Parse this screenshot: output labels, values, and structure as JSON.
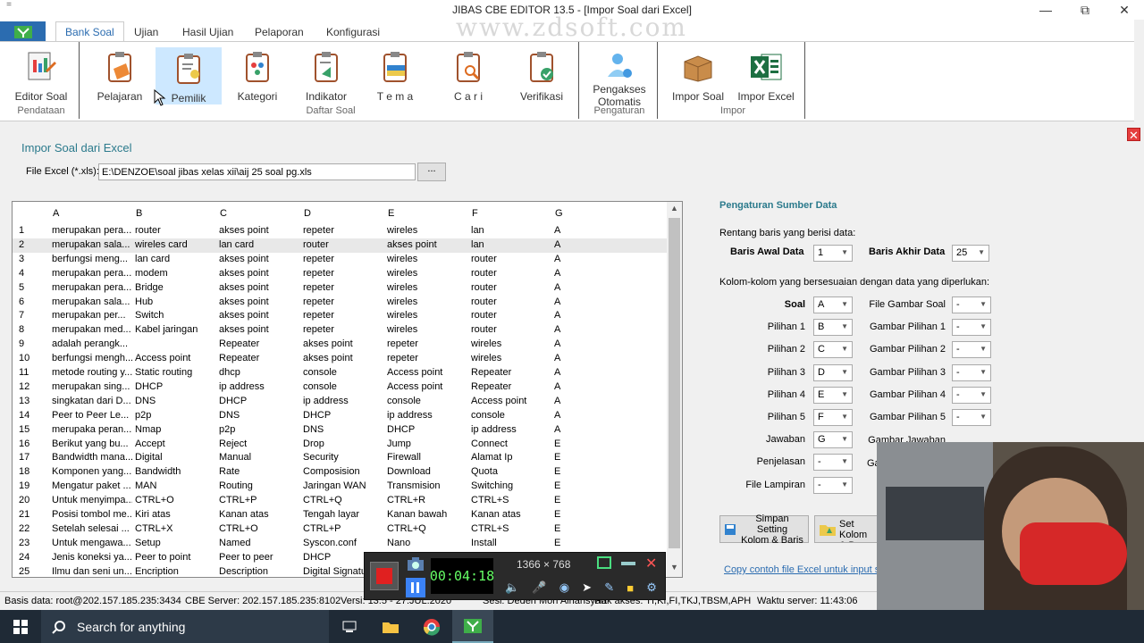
{
  "window": {
    "title": "JIBAS CBE EDITOR 13.5 - [Impor Soal dari Excel]"
  },
  "watermark": "www.zdsoft.com",
  "menu_glyph": "=",
  "tabs": [
    "Bank Soal",
    "Ujian",
    "Hasil Ujian",
    "Pelaporan",
    "Konfigurasi"
  ],
  "ribbon": {
    "buttons": {
      "editor_soal": "Editor Soal",
      "pelajaran": "Pelajaran",
      "pemilik": "Pemilik",
      "kategori": "Kategori",
      "indikator": "Indikator",
      "tema": "T e m a",
      "cari": "C a r i",
      "verifikasi": "Verifikasi",
      "pengakses_otomatis": "Pengakses\nOtomatis",
      "impor_soal": "Impor Soal",
      "impor_excel": "Impor Excel"
    },
    "groups": {
      "pendataan": "Pendataan",
      "daftar_soal": "Daftar Soal",
      "pengaturan": "Pengaturan",
      "impor": "Impor"
    }
  },
  "form": {
    "heading": "Impor Soal dari Excel",
    "file_label": "File Excel (*.xls):",
    "file_value": "E:\\DENZOE\\soal jibas xelas xii\\aij 25 soal pg.xls",
    "browse_label": "..."
  },
  "grid": {
    "columns": [
      "A",
      "B",
      "C",
      "D",
      "E",
      "F",
      "G"
    ],
    "selected_row": 2,
    "rows": [
      [
        "1",
        "merupakan pera...",
        "router",
        "akses point",
        "repeter",
        "wireles",
        "lan",
        "A"
      ],
      [
        "2",
        "merupakan sala...",
        "wireles card",
        "lan card",
        "router",
        "akses point",
        "lan",
        "A"
      ],
      [
        "3",
        "berfungsi meng...",
        "lan card",
        "akses point",
        "repeter",
        "wireles",
        "router",
        "A"
      ],
      [
        "4",
        "merupakan pera...",
        "modem",
        "akses point",
        "repeter",
        "wireles",
        "router",
        "A"
      ],
      [
        "5",
        "merupakan pera...",
        "Bridge",
        "akses point",
        "repeter",
        "wireles",
        "router",
        "A"
      ],
      [
        "6",
        "merupakan sala...",
        "Hub",
        "akses point",
        "repeter",
        "wireles",
        "router",
        "A"
      ],
      [
        "7",
        " merupakan per...",
        "Switch",
        "akses point",
        "repeter",
        "wireles",
        "router",
        "A"
      ],
      [
        "8",
        " merupakan med...",
        "Kabel jaringan",
        "akses point",
        "repeter",
        "wireles",
        "router",
        "A"
      ],
      [
        "9",
        "adalah perangk...",
        "",
        "Repeater",
        "akses point",
        "repeter",
        "wireles",
        "A"
      ],
      [
        "10",
        "berfungsi mengh...",
        "Access point",
        "Repeater",
        "akses point",
        "repeter",
        "wireles",
        "A"
      ],
      [
        "11",
        "metode routing y...",
        "Static routing",
        "dhcp",
        "console",
        "Access point",
        "Repeater",
        "A"
      ],
      [
        "12",
        "merupakan sing...",
        "DHCP",
        "ip address",
        "console",
        "Access point",
        "Repeater",
        "A"
      ],
      [
        "13",
        "singkatan dari D...",
        "DNS",
        "DHCP",
        "ip address",
        "console",
        "Access point",
        "A"
      ],
      [
        "14",
        "Peer to Peer Le...",
        "p2p",
        "DNS",
        "DHCP",
        "ip address",
        "console",
        "A"
      ],
      [
        "15",
        "merupaka peran...",
        "Nmap",
        "p2p",
        "DNS",
        "DHCP",
        "ip address",
        "A"
      ],
      [
        "16",
        "Berikut yang bu...",
        "Accept",
        "Reject",
        "Drop",
        "Jump",
        "Connect",
        "E"
      ],
      [
        "17",
        "Bandwidth mana...",
        "Digital",
        "Manual",
        "Security",
        "Firewall",
        "Alamat Ip",
        "E"
      ],
      [
        "18",
        "Komponen yang...",
        "Bandwidth",
        "Rate",
        "Composision",
        "Download",
        "Quota",
        "E"
      ],
      [
        "19",
        "Mengatur paket ...",
        "MAN",
        "Routing",
        "Jaringan WAN",
        "Transmision",
        "Switching",
        "E"
      ],
      [
        "20",
        "Untuk menyimpa...",
        "CTRL+O",
        "CTRL+P",
        "CTRL+Q",
        "CTRL+R",
        "CTRL+S",
        "E"
      ],
      [
        "21",
        "Posisi tombol me...",
        "Kiri atas",
        "Kanan atas",
        "Tengah layar",
        "Kanan bawah",
        "Kanan atas",
        "E"
      ],
      [
        "22",
        "Setelah selesai ...",
        "CTRL+X",
        "CTRL+O",
        "CTRL+P",
        "CTRL+Q",
        "CTRL+S",
        "E"
      ],
      [
        "23",
        "Untuk mengawa...",
        "Setup",
        "Named",
        "Syscon.conf",
        "Nano",
        "Install",
        "E"
      ],
      [
        "24",
        "Jenis koneksi ya...",
        "Peer to point",
        "Peer to peer",
        "DHCP",
        "",
        "",
        ""
      ],
      [
        "25",
        "Ilmu dan seni un...",
        "Encription",
        "Description",
        "Digital Signatur",
        "",
        "",
        ""
      ]
    ]
  },
  "settings": {
    "title": "Pengaturan Sumber Data",
    "range_label": "Rentang baris yang berisi data:",
    "start_label": "Baris Awal Data",
    "start_value": "1",
    "end_label": "Baris Akhir Data",
    "end_value": "25",
    "cols_label": "Kolom-kolom yang bersesuaian dengan data yang diperlukan:",
    "left_fields": [
      {
        "label": "Soal",
        "value": "A"
      },
      {
        "label": "Pilihan 1",
        "value": "B"
      },
      {
        "label": "Pilihan 2",
        "value": "C"
      },
      {
        "label": "Pilihan 3",
        "value": "D"
      },
      {
        "label": "Pilihan 4",
        "value": "E"
      },
      {
        "label": "Pilihan 5",
        "value": "F"
      },
      {
        "label": "Jawaban",
        "value": "G"
      },
      {
        "label": "Penjelasan",
        "value": "-"
      },
      {
        "label": "File Lampiran",
        "value": "-"
      }
    ],
    "right_fields": [
      {
        "label": "File Gambar Soal",
        "value": "-"
      },
      {
        "label": "Gambar Pilihan 1",
        "value": "-"
      },
      {
        "label": "Gambar Pilihan 2",
        "value": "-"
      },
      {
        "label": "Gambar Pilihan 3",
        "value": "-"
      },
      {
        "label": "Gambar Pilihan 4",
        "value": "-"
      },
      {
        "label": "Gambar Pilihan 5",
        "value": "-"
      },
      {
        "label": "Gambar Jawaban",
        "value": "-"
      }
    ],
    "right_partial": "Ga",
    "save_btn": "Simpan Setting\nKolom & Baris",
    "open_btn": "Buka Set\nKolom & B",
    "copy_link": "Copy contoh file Excel untuk input soa"
  },
  "statusbar": {
    "db": "Basis data: root@202.157.185.235:3434",
    "server": "CBE Server: 202.157.185.235:8102",
    "version": "Versi: 13.5 - 27.JUL.2020",
    "session": "Sesi: Deden Moh Alhansyah",
    "access": "Hak akses: TI,KI,FI,TKJ,TBSM,APH",
    "time": "Waktu server: 11:43:06"
  },
  "recorder": {
    "timer": "00:04:18",
    "resolution": "1366 × 768"
  },
  "taskbar": {
    "search_placeholder": "Search for anything"
  },
  "colors": {
    "accent": "#2b6cb0",
    "heading": "#2b7a8c",
    "close": "#e53e3e"
  }
}
